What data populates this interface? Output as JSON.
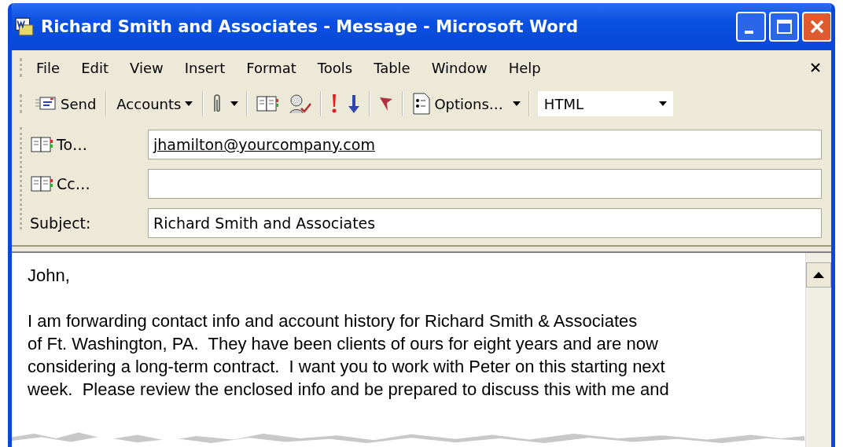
{
  "window": {
    "title": "Richard Smith and Associates - Message - Microsoft Word"
  },
  "menu": [
    "File",
    "Edit",
    "View",
    "Insert",
    "Format",
    "Tools",
    "Table",
    "Window",
    "Help"
  ],
  "toolbar": {
    "send": "Send",
    "accounts": "Accounts",
    "options": "Options…",
    "format": "HTML"
  },
  "fields": [
    {
      "kind": "address",
      "label": "To…",
      "value": "jhamilton@yourcompany.com"
    },
    {
      "kind": "address",
      "label": "Cc…"
    },
    {
      "kind": "plain",
      "label": "Subject:",
      "value": "Richard Smith and Associates"
    }
  ],
  "body": {
    "greeting": "John,",
    "lines": [
      "I am forwarding contact info and account history for Richard Smith & Associates",
      "of Ft. Washington, PA.  They have been clients of ours for eight years and are now",
      "considering a long-term contract.  I want you to work with Peter on this starting next",
      "week.  Please review the enclosed info and be prepared to discuss this with me and"
    ]
  }
}
